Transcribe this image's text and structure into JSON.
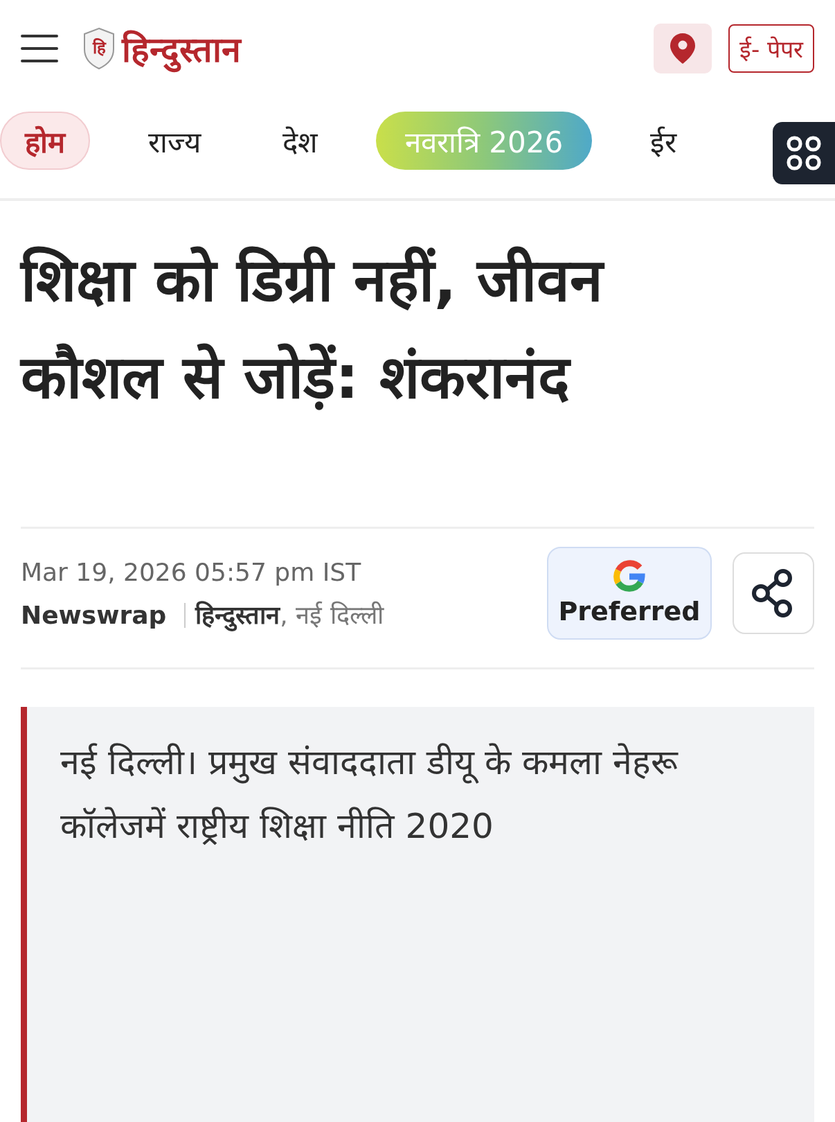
{
  "header": {
    "logo_mark": "हि",
    "logo_text": "हिन्दुस्तान",
    "epaper_button": "ई- पेपर"
  },
  "nav": [
    {
      "label": "होम",
      "selected": true,
      "kind": "plain"
    },
    {
      "label": "राज्य",
      "selected": false,
      "kind": "plain"
    },
    {
      "label": "देश",
      "selected": false,
      "kind": "plain"
    },
    {
      "label": "नवरात्रि 2026",
      "selected": false,
      "kind": "festive"
    },
    {
      "label": "ईर",
      "selected": false,
      "kind": "plain"
    }
  ],
  "article": {
    "headline": "शिक्षा को डिग्री नहीं, जीवन कौशल से जोड़ें: शंकरानंद",
    "timestamp": "Mar 19, 2026 05:57 pm IST",
    "author": "Newswrap",
    "source": "**हिन्दुस्तान**, नई दिल्ली",
    "preferred_button": "Preferred",
    "summary": "नई दिल्ली। प्रमुख संवाददाता डीयू के कमला नेहरू कॉलेजमें राष्ट्रीय शिक्षा नीति 2020"
  }
}
